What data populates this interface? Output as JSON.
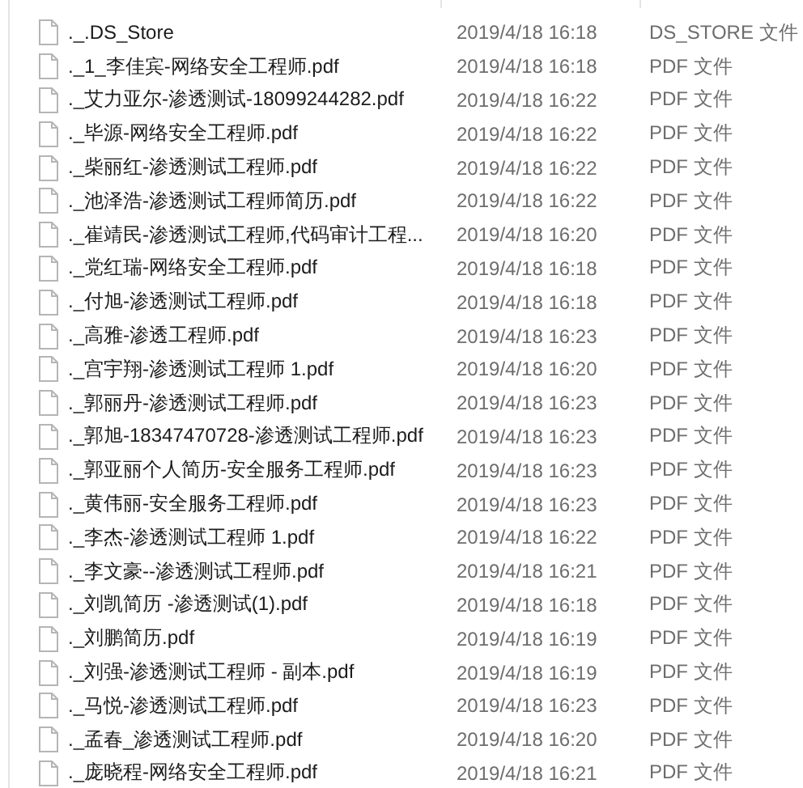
{
  "files": [
    {
      "name": "._.DS_Store",
      "modified": "2019/4/18 16:18",
      "type": "DS_STORE 文件"
    },
    {
      "name": "._1_李佳宾-网络安全工程师.pdf",
      "modified": "2019/4/18 16:18",
      "type": "PDF 文件"
    },
    {
      "name": "._艾力亚尔-渗透测试-18099244282.pdf",
      "modified": "2019/4/18 16:22",
      "type": "PDF 文件"
    },
    {
      "name": "._毕源-网络安全工程师.pdf",
      "modified": "2019/4/18 16:22",
      "type": "PDF 文件"
    },
    {
      "name": "._柴丽红-渗透测试工程师.pdf",
      "modified": "2019/4/18 16:22",
      "type": "PDF 文件"
    },
    {
      "name": "._池泽浩-渗透测试工程师简历.pdf",
      "modified": "2019/4/18 16:22",
      "type": "PDF 文件"
    },
    {
      "name": "._崔靖民-渗透测试工程师,代码审计工程...",
      "modified": "2019/4/18 16:20",
      "type": "PDF 文件"
    },
    {
      "name": "._党红瑞-网络安全工程师.pdf",
      "modified": "2019/4/18 16:18",
      "type": "PDF 文件"
    },
    {
      "name": "._付旭-渗透测试工程师.pdf",
      "modified": "2019/4/18 16:18",
      "type": "PDF 文件"
    },
    {
      "name": "._高雅-渗透工程师.pdf",
      "modified": "2019/4/18 16:23",
      "type": "PDF 文件"
    },
    {
      "name": "._宫宇翔-渗透测试工程师 1.pdf",
      "modified": "2019/4/18 16:20",
      "type": "PDF 文件"
    },
    {
      "name": "._郭丽丹-渗透测试工程师.pdf",
      "modified": "2019/4/18 16:23",
      "type": "PDF 文件"
    },
    {
      "name": "._郭旭-18347470728-渗透测试工程师.pdf",
      "modified": "2019/4/18 16:23",
      "type": "PDF 文件"
    },
    {
      "name": "._郭亚丽个人简历-安全服务工程师.pdf",
      "modified": "2019/4/18 16:23",
      "type": "PDF 文件"
    },
    {
      "name": "._黄伟丽-安全服务工程师.pdf",
      "modified": "2019/4/18 16:23",
      "type": "PDF 文件"
    },
    {
      "name": "._李杰-渗透测试工程师 1.pdf",
      "modified": "2019/4/18 16:22",
      "type": "PDF 文件"
    },
    {
      "name": "._李文豪--渗透测试工程师.pdf",
      "modified": "2019/4/18 16:21",
      "type": "PDF 文件"
    },
    {
      "name": "._刘凯简历 -渗透测试(1).pdf",
      "modified": "2019/4/18 16:18",
      "type": "PDF 文件"
    },
    {
      "name": "._刘鹏简历.pdf",
      "modified": "2019/4/18 16:19",
      "type": "PDF 文件"
    },
    {
      "name": "._刘强-渗透测试工程师 - 副本.pdf",
      "modified": "2019/4/18 16:19",
      "type": "PDF 文件"
    },
    {
      "name": "._马悦-渗透测试工程师.pdf",
      "modified": "2019/4/18 16:23",
      "type": "PDF 文件"
    },
    {
      "name": "._孟春_渗透测试工程师.pdf",
      "modified": "2019/4/18 16:20",
      "type": "PDF 文件"
    },
    {
      "name": "._庞晓程-网络安全工程师.pdf",
      "modified": "2019/4/18 16:21",
      "type": "PDF 文件"
    }
  ]
}
